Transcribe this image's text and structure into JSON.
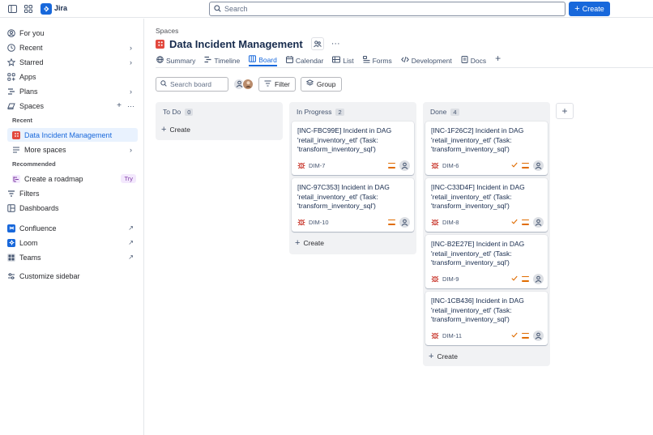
{
  "app": {
    "brand": "Jira"
  },
  "search": {
    "placeholder": "Search"
  },
  "topbar": {
    "create_label": "Create"
  },
  "sidebar": {
    "for_you": "For you",
    "recent": "Recent",
    "starred": "Starred",
    "apps": "Apps",
    "plans": "Plans",
    "spaces": "Spaces",
    "recent_head": "Recent",
    "active_project": "Data Incident Management",
    "more_spaces": "More spaces",
    "recommended_head": "Recommended",
    "create_roadmap": "Create a roadmap",
    "try_badge": "Try",
    "filters": "Filters",
    "dashboards": "Dashboards",
    "confluence": "Confluence",
    "loom": "Loom",
    "teams": "Teams",
    "customize": "Customize sidebar"
  },
  "main": {
    "breadcrumb": "Spaces",
    "title": "Data Incident Management",
    "tabs": [
      "Summary",
      "Timeline",
      "Board",
      "Calendar",
      "List",
      "Forms",
      "Development",
      "Docs"
    ],
    "board_search_placeholder": "Search board",
    "filter_label": "Filter",
    "group_label": "Group"
  },
  "columns": [
    {
      "name": "To Do",
      "count": "0",
      "create_label": "Create",
      "cards": []
    },
    {
      "name": "In Progress",
      "count": "2",
      "create_label": "Create",
      "cards": [
        {
          "title": "[INC-FBC99E] Incident in DAG 'retail_inventory_etl' (Task: 'transform_inventory_sql')",
          "key": "DIM-7",
          "done": false
        },
        {
          "title": "[INC-97C353] Incident in DAG 'retail_inventory_etl' (Task: 'transform_inventory_sql')",
          "key": "DIM-10",
          "done": false
        }
      ]
    },
    {
      "name": "Done",
      "count": "4",
      "create_label": "Create",
      "cards": [
        {
          "title": "[INC-1F26C2] Incident in DAG 'retail_inventory_etl' (Task: 'transform_inventory_sql')",
          "key": "DIM-6",
          "done": true
        },
        {
          "title": "[INC-C33D4F] Incident in DAG 'retail_inventory_etl' (Task: 'transform_inventory_sql')",
          "key": "DIM-8",
          "done": true
        },
        {
          "title": "[INC-B2E27E] Incident in DAG 'retail_inventory_etl' (Task: 'transform_inventory_sql')",
          "key": "DIM-9",
          "done": true
        },
        {
          "title": "[INC-1CB436] Incident in DAG 'retail_inventory_etl' (Task: 'transform_inventory_sql')",
          "key": "DIM-11",
          "done": true
        }
      ]
    }
  ],
  "colors": {
    "accent": "#1868db",
    "project": "#e2483d",
    "priority": "#e06c00"
  }
}
